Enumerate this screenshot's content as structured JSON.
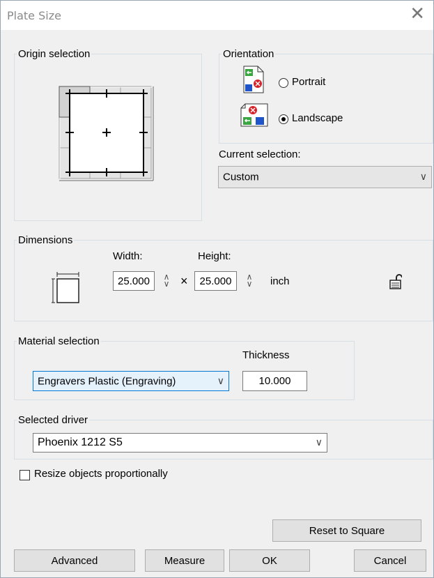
{
  "window": {
    "title": "Plate Size",
    "close_glyph": "✕"
  },
  "origin": {
    "label": "Origin selection"
  },
  "orientation": {
    "label": "Orientation",
    "portrait_label": "Portrait",
    "landscape_label": "Landscape",
    "selected": "Landscape"
  },
  "current_selection": {
    "label": "Current selection:",
    "value": "Custom"
  },
  "dimensions": {
    "label": "Dimensions",
    "width_label": "Width:",
    "height_label": "Height:",
    "width_value": "25.000",
    "height_value": "25.000",
    "times": "×",
    "unit": "inch"
  },
  "material": {
    "label": "Material selection",
    "thickness_label": "Thickness",
    "value": "Engravers Plastic (Engraving)",
    "thickness_value": "10.000"
  },
  "driver": {
    "label": "Selected driver",
    "value": "Phoenix 1212 S5"
  },
  "resize": {
    "label": "Resize objects proportionally",
    "checked": false
  },
  "buttons": {
    "reset": "Reset to Square",
    "advanced": "Advanced",
    "measure": "Measure",
    "ok": "OK",
    "cancel": "Cancel"
  },
  "glyphs": {
    "caret": "∨",
    "spin_up": "∧",
    "spin_down": "∨"
  },
  "colors": {
    "accent": "#0078d7",
    "background": "#f0f0f0",
    "title_text": "#8a8a8a"
  }
}
